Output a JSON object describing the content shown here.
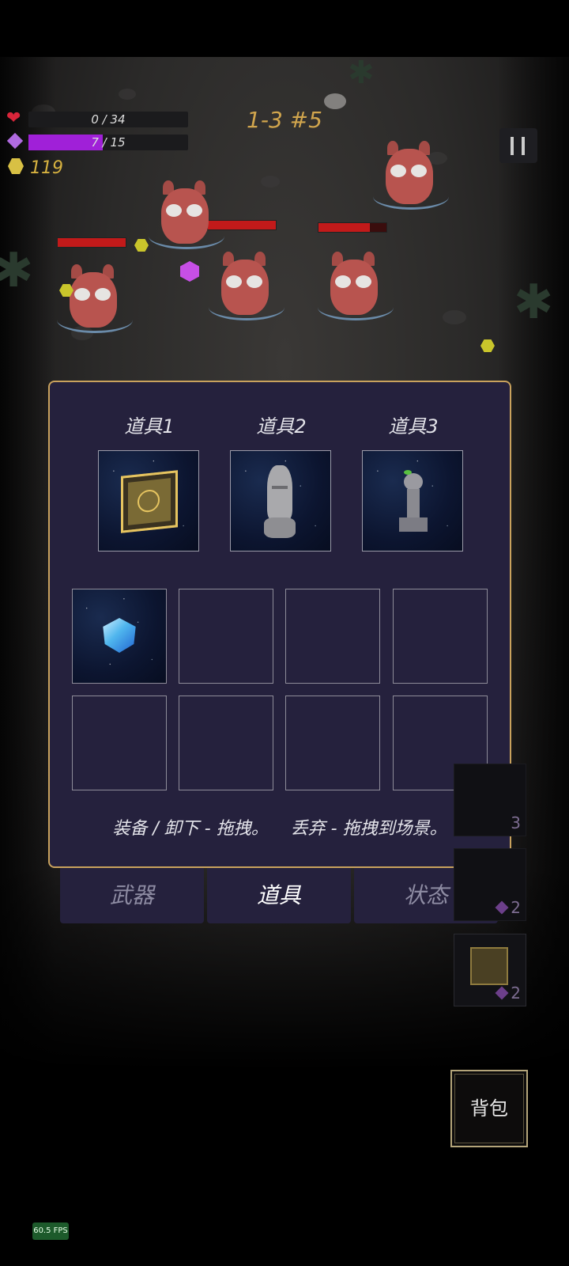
{
  "hud": {
    "health_text": "0 / 34",
    "health_fraction": 0.0,
    "mana_text": "7 / 15",
    "mana_fraction": 0.467,
    "gold": "119",
    "stage": "1-3 #5",
    "colors": {
      "mana": "#a020d8",
      "gold": "#d7b240",
      "stage": "#d1a54d"
    }
  },
  "enemies": [
    {
      "hp_fraction": 1.0
    },
    {
      "hp_fraction": 1.0
    },
    {
      "hp_fraction": 1.0
    },
    {
      "hp_fraction": 0.75
    }
  ],
  "panel": {
    "equip_slots": [
      {
        "label": "道具1",
        "item": "golden-rune-cube-icon"
      },
      {
        "label": "道具2",
        "item": "moai-statue-icon"
      },
      {
        "label": "道具3",
        "item": "chess-tower-icon"
      }
    ],
    "inventory": [
      {
        "item": "blue-gem-icon"
      },
      {
        "item": ""
      },
      {
        "item": ""
      },
      {
        "item": ""
      },
      {
        "item": ""
      },
      {
        "item": ""
      },
      {
        "item": ""
      },
      {
        "item": ""
      }
    ],
    "hint": "装备 / 卸下 - 拖拽。    丢弃 - 拖拽到场景。"
  },
  "tabs": [
    {
      "label": "武器",
      "active": false
    },
    {
      "label": "道具",
      "active": true
    },
    {
      "label": "状态",
      "active": false
    }
  ],
  "side_items": [
    {
      "count": "3"
    },
    {
      "count": "2"
    },
    {
      "count": "2"
    }
  ],
  "bag_button": "背包",
  "fps": "60.5 FPS"
}
